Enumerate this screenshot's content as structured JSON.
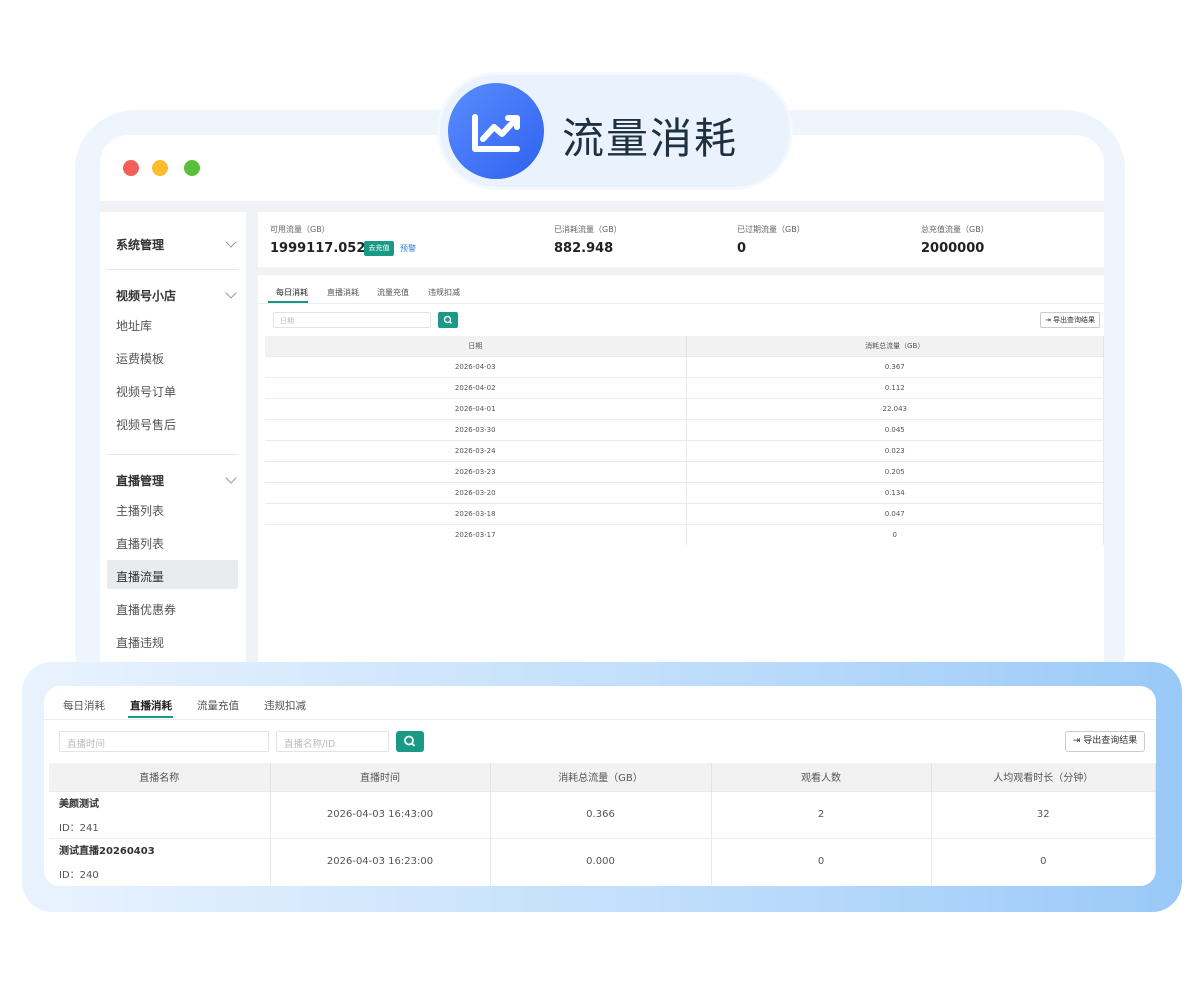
{
  "badge": {
    "title": "流量消耗",
    "icon": "chart-line-icon"
  },
  "window_controls": [
    "close",
    "minimize",
    "maximize"
  ],
  "sidebar": {
    "groups": [
      {
        "title": "系统管理",
        "items": []
      },
      {
        "title": "视频号小店",
        "items": [
          "地址库",
          "运费模板",
          "视频号订单",
          "视频号售后"
        ]
      },
      {
        "title": "直播管理",
        "items": [
          "主播列表",
          "直播列表",
          "直播流量",
          "直播优惠券",
          "直播违规"
        ],
        "active": "直播流量"
      }
    ]
  },
  "stats": {
    "available_label": "可用流量（GB）",
    "available_value": "1999117.052",
    "recharge_btn": "去充值",
    "warn_link": "预警",
    "consumed_label": "已消耗流量（GB）",
    "consumed_value": "882.948",
    "expired_label": "已过期流量（GB）",
    "expired_value": "0",
    "total_label": "总充值流量（GB）",
    "total_value": "2000000"
  },
  "daily": {
    "tabs": [
      "每日消耗",
      "直播消耗",
      "流量充值",
      "违规扣减"
    ],
    "active_tab": "每日消耗",
    "date_placeholder": "日期",
    "export_label": "导出查询结果",
    "columns": [
      "日期",
      "消耗总流量（GB）"
    ],
    "rows": [
      [
        "2026-04-03",
        "0.367"
      ],
      [
        "2026-04-02",
        "0.112"
      ],
      [
        "2026-04-01",
        "22.043"
      ],
      [
        "2026-03-30",
        "0.045"
      ],
      [
        "2026-03-24",
        "0.023"
      ],
      [
        "2026-03-23",
        "0.205"
      ],
      [
        "2026-03-20",
        "0.134"
      ],
      [
        "2026-03-18",
        "0.047"
      ],
      [
        "2026-03-17",
        "0"
      ]
    ]
  },
  "live": {
    "tabs": [
      "每日消耗",
      "直播消耗",
      "流量充值",
      "违规扣减"
    ],
    "active_tab": "直播消耗",
    "time_placeholder": "直播时间",
    "name_placeholder": "直播名称/ID",
    "export_label": "导出查询结果",
    "columns": [
      "直播名称",
      "直播时间",
      "消耗总流量（GB）",
      "观看人数",
      "人均观看时长（分钟）"
    ],
    "rows": [
      {
        "name": "美颜测试",
        "id": "ID：241",
        "time": "2026-04-03 16:43:00",
        "traffic": "0.366",
        "viewers": "2",
        "avg": "32"
      },
      {
        "name": "测试直播20260403",
        "id": "ID：240",
        "time": "2026-04-03 16:23:00",
        "traffic": "0.000",
        "viewers": "0",
        "avg": "0"
      }
    ]
  }
}
